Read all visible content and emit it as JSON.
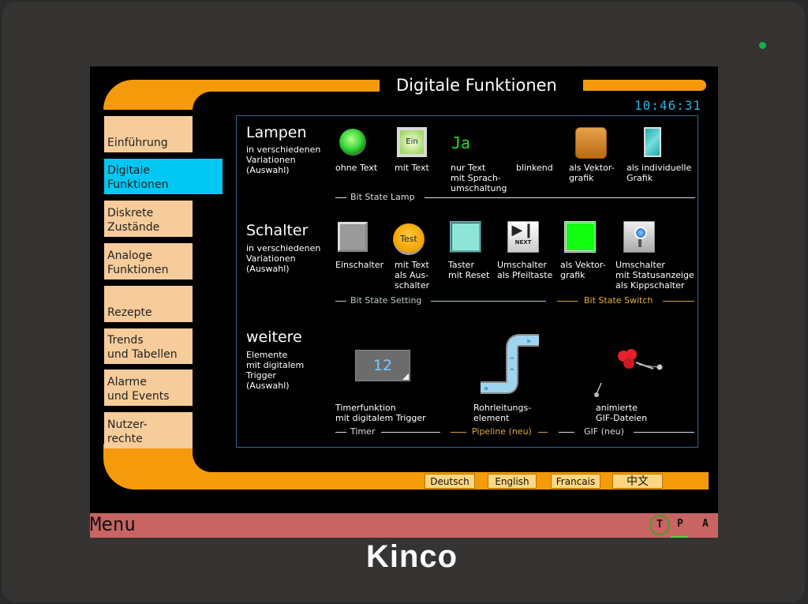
{
  "device": {
    "brand": "Kinco",
    "power_led_color": "#14b04a"
  },
  "header": {
    "title": "Digitale Funktionen",
    "clock": "10:46:31",
    "accent_color": "#f59a0b"
  },
  "sidebar": {
    "items": [
      {
        "label": "Einführung",
        "active": false
      },
      {
        "label": "Digitale\nFunktionen",
        "active": true
      },
      {
        "label": "Diskrete\nZustände",
        "active": false
      },
      {
        "label": "Analoge\nFunktionen",
        "active": false
      },
      {
        "label": "Rezepte",
        "active": false
      },
      {
        "label": "Trends\nund Tabellen",
        "active": false
      },
      {
        "label": "Alarme\nund Events",
        "active": false
      },
      {
        "label": "Nutzer-\nrechte",
        "active": false
      }
    ]
  },
  "sections": {
    "lampen": {
      "title": "Lampen",
      "subtitle": "in verschiedenen\nVariationen\n(Auswahl)",
      "items": [
        {
          "icon": "green-lamp-icon",
          "caption": "ohne Text"
        },
        {
          "icon": "ein-lamp-icon",
          "icon_text": "Ein",
          "caption": "mit Text"
        },
        {
          "icon": "text-lamp",
          "icon_text": "Ja",
          "caption": "nur Text\nmit Sprach-\numschaltung"
        },
        {
          "icon": "blink-lamp",
          "caption": "blinkend"
        },
        {
          "icon": "vector-lamp-icon",
          "caption": "als Vektor-\ngrafik"
        },
        {
          "icon": "glass-window-icon",
          "caption": "als individuelle\nGrafik"
        }
      ],
      "group_label": "Bit State Lamp"
    },
    "schalter": {
      "title": "Schalter",
      "subtitle": "in verschiedenen\nVariationen\n(Auswahl)",
      "items": [
        {
          "icon": "gray-switch-icon",
          "caption": "Einschalter"
        },
        {
          "icon": "test-button-icon",
          "icon_text": "Test",
          "caption": "mit Text\nals Aus-\nschalter"
        },
        {
          "icon": "cyan-button-icon",
          "caption": "Taster\nmit Reset"
        },
        {
          "icon": "next-arrow-icon",
          "icon_text": "NEXT",
          "caption": "Umschalter\nals Pfeiltaste"
        },
        {
          "icon": "green-vector-switch-icon",
          "caption": "als Vektor-\ngrafik"
        },
        {
          "icon": "toggle-switch-icon",
          "caption": "Umschalter\nmit Statusanzeige\nals Kippschalter"
        }
      ],
      "group_labels": [
        "Bit State Setting",
        "Bit State Switch"
      ]
    },
    "weitere": {
      "title": "weitere",
      "subtitle": "Elemente\nmit digitalem\nTrigger\n(Auswahl)",
      "items": [
        {
          "icon": "timer-display",
          "icon_text": "12",
          "caption": "Timerfunktion\nmit digitalem Trigger"
        },
        {
          "icon": "pipeline-icon",
          "caption": "Rohrleitungs-\nelement"
        },
        {
          "icon": "animated-gif-icon",
          "caption": "animierte\nGIF-Dateien"
        }
      ],
      "group_labels": [
        "Timer",
        "Pipeline (neu)",
        "GIF (neu)"
      ]
    }
  },
  "languages": [
    "Deutsch",
    "English",
    "Francais",
    "中文"
  ],
  "statusbar": {
    "menu_label": "Menu",
    "indicators": [
      "T",
      "P",
      "A"
    ],
    "background_color": "#c86462"
  }
}
